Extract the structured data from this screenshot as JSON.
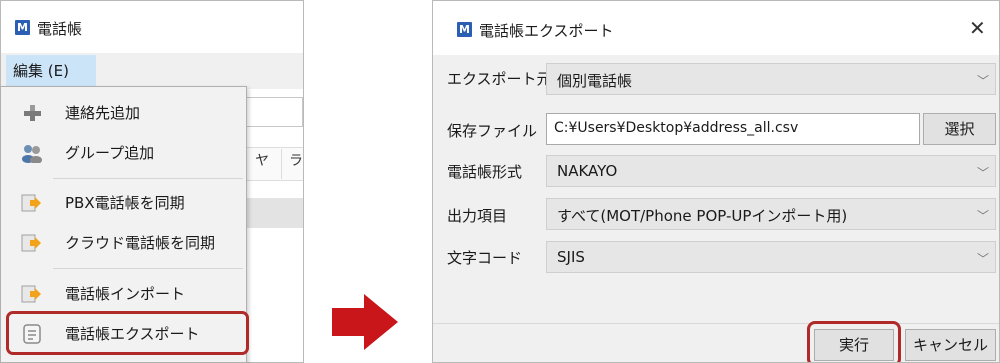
{
  "left_window": {
    "title": "電話帳",
    "logo_letter": "M",
    "menu": {
      "edit_label": "編集 (E)"
    },
    "background_columns": [
      "ヤ",
      "ラ"
    ],
    "dropdown_items": [
      {
        "label": "連絡先追加",
        "icon": "plus-icon"
      },
      {
        "label": "グループ追加",
        "icon": "people-icon"
      },
      {
        "label": "PBX電話帳を同期",
        "icon": "arrow-doc-icon"
      },
      {
        "label": "クラウド電話帳を同期",
        "icon": "arrow-doc-icon"
      },
      {
        "label": "電話帳インポート",
        "icon": "arrow-doc-icon"
      },
      {
        "label": "電話帳エクスポート",
        "icon": "document-icon"
      }
    ]
  },
  "dialog": {
    "title": "電話帳エクスポート",
    "logo_letter": "M",
    "fields": {
      "source": {
        "label": "エクスポート元",
        "value": "個別電話帳"
      },
      "file": {
        "label": "保存ファイル",
        "value": "C:¥Users¥Desktop¥address_all.csv",
        "button": "選択"
      },
      "format": {
        "label": "電話帳形式",
        "value": "NAKAYO"
      },
      "output": {
        "label": "出力項目",
        "value": "すべて(MOT/Phone POP-UPインポート用)"
      },
      "encoding": {
        "label": "文字コード",
        "value": "SJIS"
      }
    },
    "buttons": {
      "run": "実行",
      "cancel": "キャンセル"
    }
  },
  "colors": {
    "highlight": "#b02a2a",
    "arrow": "#c8161b",
    "brand": "#2b5fb4"
  }
}
